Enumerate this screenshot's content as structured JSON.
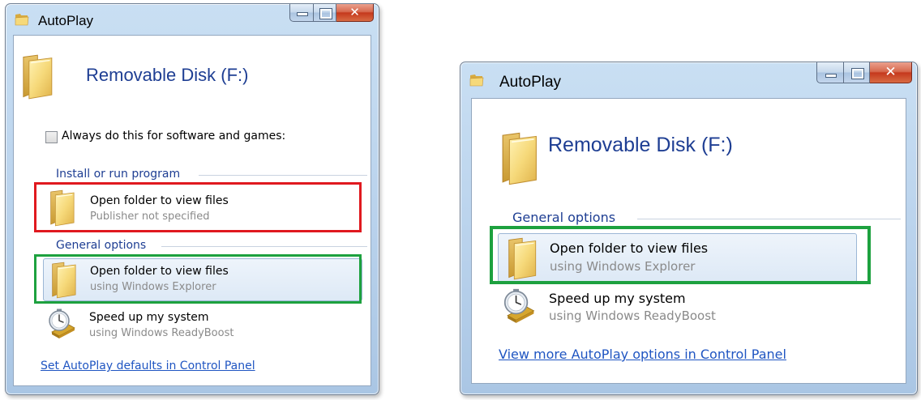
{
  "colors": {
    "heading_blue": "#1e3e93",
    "link_blue": "#1f55c2",
    "subtext_gray": "#8a8a8a",
    "highlight_red": "#e0191f",
    "highlight_green": "#1da13f"
  },
  "window1": {
    "title": "AutoPlay",
    "device": "Removable Disk (F:)",
    "always_checkbox": {
      "checked": false,
      "label": "Always do this for software and games:"
    },
    "groups": [
      {
        "heading": "Install or run program",
        "items": [
          {
            "title": "Open folder to view files",
            "subtitle": "Publisher not specified",
            "icon": "folder-icon"
          }
        ]
      },
      {
        "heading": "General options",
        "items": [
          {
            "title": "Open folder to view files",
            "subtitle": "using Windows Explorer",
            "icon": "folder-icon",
            "selected": true
          },
          {
            "title": "Speed up my system",
            "subtitle": "using Windows ReadyBoost",
            "icon": "readyboost-icon"
          }
        ]
      }
    ],
    "link": "Set AutoPlay defaults in Control Panel"
  },
  "window2": {
    "title": "AutoPlay",
    "device": "Removable Disk (F:)",
    "groups": [
      {
        "heading": "General options",
        "items": [
          {
            "title": "Open folder to view files",
            "subtitle": "using Windows Explorer",
            "icon": "folder-icon",
            "selected": true
          },
          {
            "title": "Speed up my system",
            "subtitle": "using Windows ReadyBoost",
            "icon": "readyboost-icon"
          }
        ]
      }
    ],
    "link": "View more AutoPlay options in Control Panel"
  }
}
